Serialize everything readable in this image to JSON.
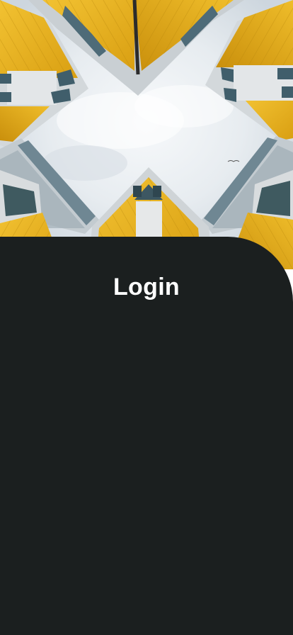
{
  "screen": {
    "title": "Login"
  },
  "hero": {
    "subject": "cube-houses-sky-photo"
  },
  "colors": {
    "panel_background": "#1b1f1f",
    "title_text": "#ffffff",
    "facade_yellow": "#e8b51f",
    "sky": "#e9edf1"
  }
}
